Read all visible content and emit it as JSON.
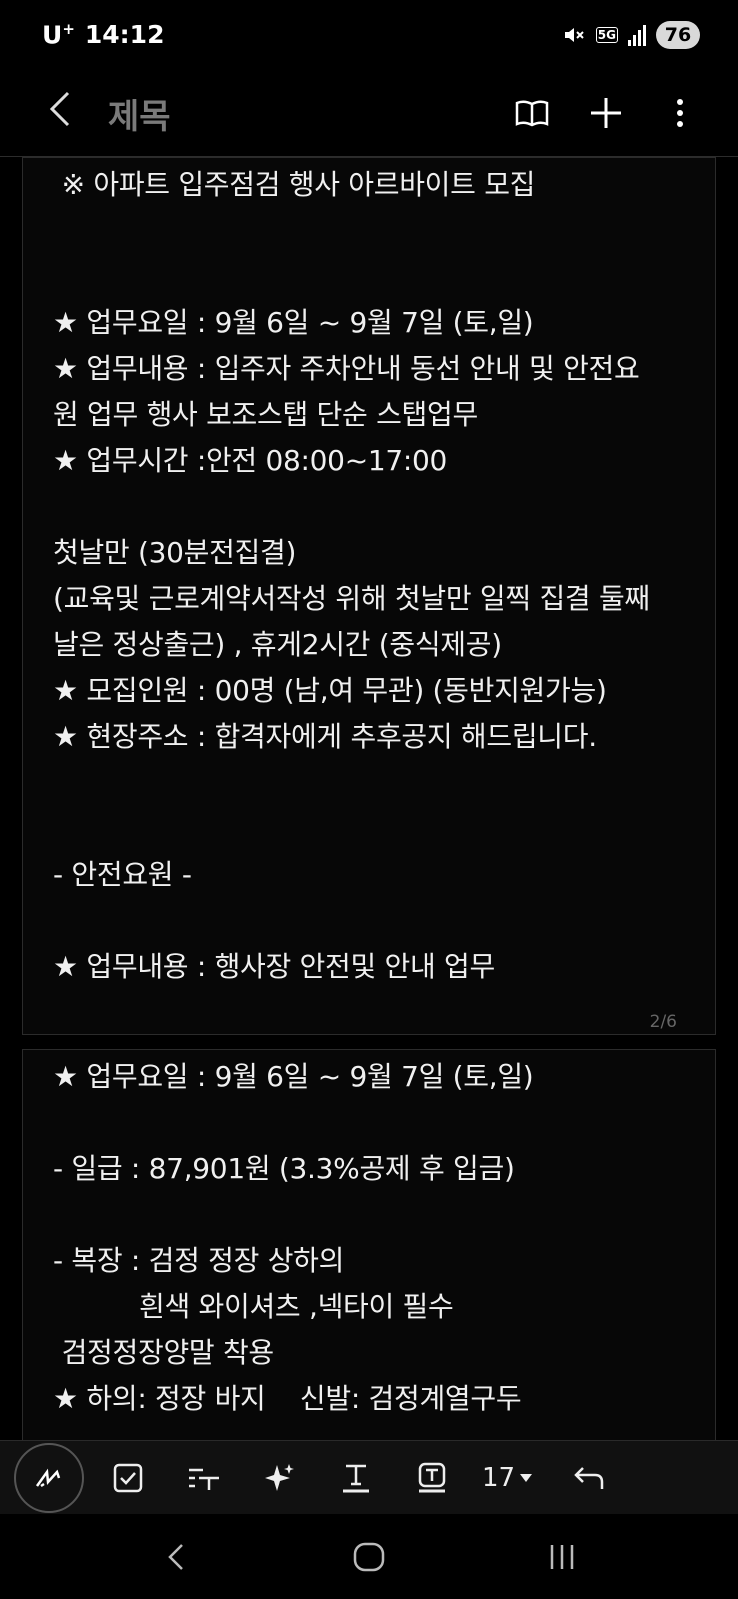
{
  "status": {
    "carrier": "U",
    "carrier_sup": "+",
    "time": "14:12",
    "network": "5G",
    "battery": "76"
  },
  "appbar": {
    "title": "제목"
  },
  "page1": {
    "lines": [
      " ※ 아파트 입주점검 행사 아르바이트 모집",
      "",
      "",
      "★ 업무요일 : 9월 6일 ~ 9월 7일 (토,일)",
      "★ 업무내용 : 입주자 주차안내 동선 안내 및 안전요",
      "원 업무 행사 보조스탭 단순 스탭업무",
      "★ 업무시간 :안전 08:00~17:00",
      "",
      "첫날만 (30분전집결)",
      "(교육및 근로계약서작성 위해 첫날만 일찍 집결 둘째",
      "날은 정상출근) , 휴게2시간 (중식제공)",
      "★ 모집인원 : 00명 (남,여 무관) (동반지원가능)",
      "★ 현장주소 : 합격자에게 추후공지 해드립니다.",
      "",
      "",
      "- 안전요원 -",
      "",
      "★ 업무내용 : 행사장 안전및 안내 업무"
    ],
    "page_number": "2/6"
  },
  "page2": {
    "lines": [
      "★ 업무요일 : 9월 6일 ~ 9월 7일 (토,일)",
      "",
      "- 일급 : 87,901원 (3.3%공제 후 입금)",
      "",
      "- 복장 : 검정 정장 상하의",
      "          흰색 와이셔츠 ,넥타이 필수",
      " 검정정장양말 착용",
      "★ 하의: 정장 바지    신발: 검정계열구두"
    ]
  },
  "format_bar": {
    "font_size": "17"
  }
}
